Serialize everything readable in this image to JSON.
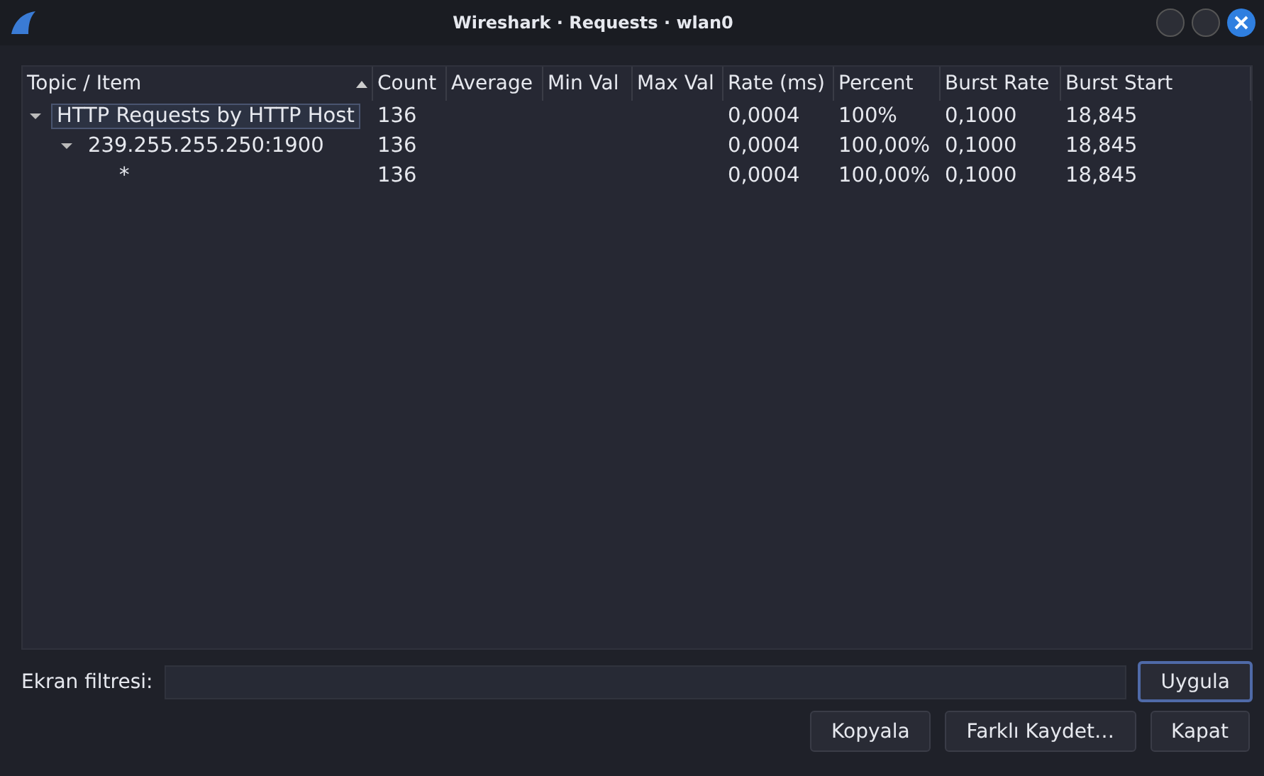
{
  "window": {
    "title": "Wireshark · Requests · wlan0"
  },
  "table": {
    "columns": [
      {
        "label": "Topic / Item",
        "sorted": true
      },
      {
        "label": "Count",
        "sorted": false
      },
      {
        "label": "Average",
        "sorted": false
      },
      {
        "label": "Min Val",
        "sorted": false
      },
      {
        "label": "Max Val",
        "sorted": false
      },
      {
        "label": "Rate (ms)",
        "sorted": false
      },
      {
        "label": "Percent",
        "sorted": false
      },
      {
        "label": "Burst Rate",
        "sorted": false
      },
      {
        "label": "Burst Start",
        "sorted": false
      }
    ],
    "rows": [
      {
        "item": "HTTP Requests by HTTP Host",
        "selected": true,
        "expanded": true,
        "count": "136",
        "rate": "0,0004",
        "percent": "100%",
        "burst_rate": "0,1000",
        "burst_start": "18,845",
        "children": [
          {
            "item": "239.255.255.250:1900",
            "selected": false,
            "expanded": true,
            "count": "136",
            "rate": "0,0004",
            "percent": "100,00%",
            "burst_rate": "0,1000",
            "burst_start": "18,845",
            "children": [
              {
                "item": "*",
                "selected": false,
                "count": "136",
                "rate": "0,0004",
                "percent": "100,00%",
                "burst_rate": "0,1000",
                "burst_start": "18,845"
              }
            ]
          }
        ]
      }
    ]
  },
  "filter": {
    "label": "Ekran filtresi:"
  },
  "buttons": [
    {
      "label": "Uygula",
      "kind": "default"
    },
    {
      "label": "Kopyala",
      "kind": "normal"
    },
    {
      "label": "Farklı Kaydet…",
      "kind": "normal"
    },
    {
      "label": "Kapat",
      "kind": "normal"
    }
  ]
}
